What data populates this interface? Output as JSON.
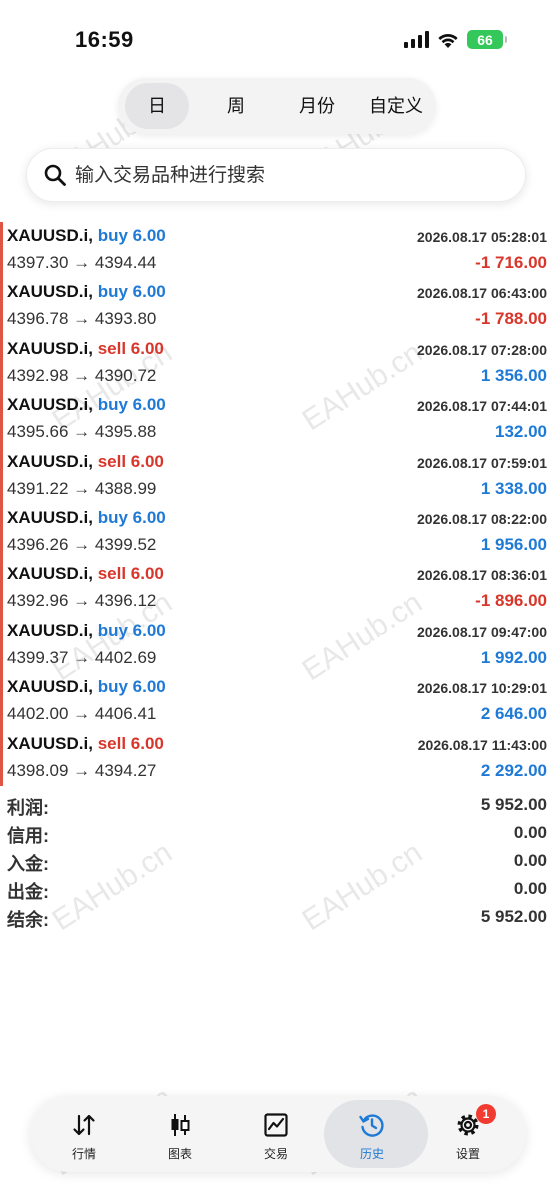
{
  "status_bar": {
    "time": "16:59",
    "battery": "66"
  },
  "period_tabs": [
    {
      "label": "日",
      "active": true
    },
    {
      "label": "周",
      "active": false
    },
    {
      "label": "月份",
      "active": false
    },
    {
      "label": "自定义",
      "active": false
    }
  ],
  "search": {
    "placeholder": "输入交易品种进行搜索"
  },
  "trades": [
    {
      "symbol": "XAUUSD.i,",
      "side": "buy 6.00",
      "time": "2026.08.17 05:28:01",
      "prices": "4397.30 → 4394.44",
      "profit": "-1 716.00"
    },
    {
      "symbol": "XAUUSD.i,",
      "side": "buy 6.00",
      "time": "2026.08.17 06:43:00",
      "prices": "4396.78 → 4393.80",
      "profit": "-1 788.00"
    },
    {
      "symbol": "XAUUSD.i,",
      "side": "sell 6.00",
      "time": "2026.08.17 07:28:00",
      "prices": "4392.98 → 4390.72",
      "profit": "1 356.00"
    },
    {
      "symbol": "XAUUSD.i,",
      "side": "buy 6.00",
      "time": "2026.08.17 07:44:01",
      "prices": "4395.66 → 4395.88",
      "profit": "132.00"
    },
    {
      "symbol": "XAUUSD.i,",
      "side": "sell 6.00",
      "time": "2026.08.17 07:59:01",
      "prices": "4391.22 → 4388.99",
      "profit": "1 338.00"
    },
    {
      "symbol": "XAUUSD.i,",
      "side": "buy 6.00",
      "time": "2026.08.17 08:22:00",
      "prices": "4396.26 → 4399.52",
      "profit": "1 956.00"
    },
    {
      "symbol": "XAUUSD.i,",
      "side": "sell 6.00",
      "time": "2026.08.17 08:36:01",
      "prices": "4392.96 → 4396.12",
      "profit": "-1 896.00"
    },
    {
      "symbol": "XAUUSD.i,",
      "side": "buy 6.00",
      "time": "2026.08.17 09:47:00",
      "prices": "4399.37 → 4402.69",
      "profit": "1 992.00"
    },
    {
      "symbol": "XAUUSD.i,",
      "side": "buy 6.00",
      "time": "2026.08.17 10:29:01",
      "prices": "4402.00 → 4406.41",
      "profit": "2 646.00"
    },
    {
      "symbol": "XAUUSD.i,",
      "side": "sell 6.00",
      "time": "2026.08.17 11:43:00",
      "prices": "4398.09 → 4394.27",
      "profit": "2 292.00"
    }
  ],
  "summary": [
    {
      "label": "利润:",
      "value": "5 952.00"
    },
    {
      "label": "信用:",
      "value": "0.00"
    },
    {
      "label": "入金:",
      "value": "0.00"
    },
    {
      "label": "出金:",
      "value": "0.00"
    },
    {
      "label": "结余:",
      "value": "5 952.00"
    }
  ],
  "bottom_nav": [
    {
      "label": "行情",
      "icon": "quotes-arrows-icon",
      "active": false
    },
    {
      "label": "图表",
      "icon": "candlestick-chart-icon",
      "active": false
    },
    {
      "label": "交易",
      "icon": "trade-chart-icon",
      "active": false
    },
    {
      "label": "历史",
      "icon": "history-clock-icon",
      "active": true
    },
    {
      "label": "设置",
      "icon": "gear-icon",
      "active": false,
      "badge": "1"
    }
  ],
  "watermark": "EAHub.cn",
  "colors": {
    "buy": "#1e7ad6",
    "sell": "#d9362b",
    "accent": "#1e7ad6",
    "badge": "#f23b30",
    "battery": "#34c759"
  }
}
